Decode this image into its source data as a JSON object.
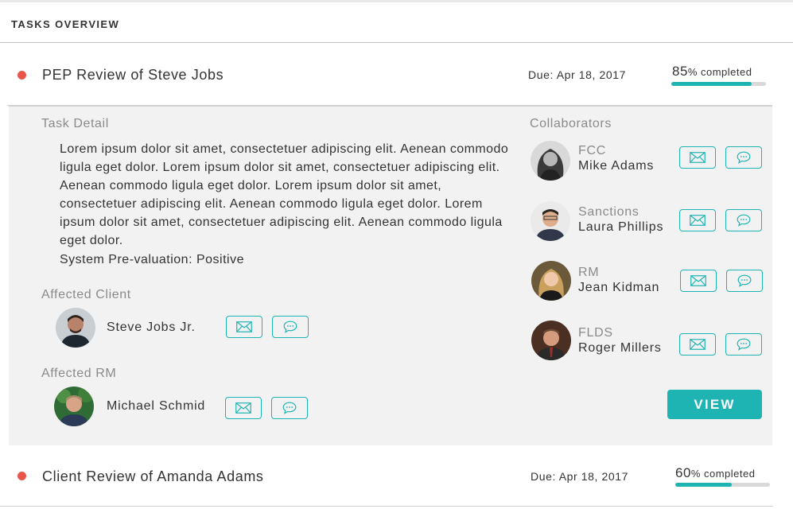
{
  "header": {
    "title": "TASKS OVERVIEW"
  },
  "colors": {
    "accent": "#1fb4b4",
    "status_dot": "#e8574a",
    "muted_text": "#8a8a8a"
  },
  "tasks": [
    {
      "title": "PEP Review of Steve Jobs",
      "due": "Due: Apr 18, 2017",
      "percent": 85,
      "percent_sign": "%",
      "completed_label": " completed",
      "detail": {
        "task_detail_label": "Task Detail",
        "text": "Lorem ipsum dolor sit amet, consectetuer adipiscing elit. Aenean commodo ligula eget dolor. Lorem ipsum dolor sit amet, consectetuer adipiscing elit. Aenean commodo ligula eget dolor. Lorem ipsum dolor sit amet, consectetuer adipiscing elit. Aenean commodo ligula eget dolor. Lorem ipsum dolor sit amet, consectetuer adipiscing elit. Aenean commodo ligula eget dolor.",
        "prevaluation": "System Pre-valuation: Positive",
        "affected_client_label": "Affected Client",
        "affected_client": {
          "name": "Steve Jobs Jr."
        },
        "affected_rm_label": "Affected RM",
        "affected_rm": {
          "name": "Michael Schmid"
        },
        "collaborators_label": "Collaborators",
        "collaborators": [
          {
            "role": "FCC",
            "name": "Mike Adams"
          },
          {
            "role": "Sanctions",
            "name": "Laura Phillips"
          },
          {
            "role": "RM",
            "name": "Jean Kidman"
          },
          {
            "role": "FLDS",
            "name": "Roger Millers"
          }
        ],
        "view_label": "VIEW"
      }
    },
    {
      "title": "Client Review of Amanda Adams",
      "due": "Due: Apr 18, 2017",
      "percent": 60,
      "percent_sign": "%",
      "completed_label": " completed"
    }
  ],
  "icons": {
    "mail": "mail-icon",
    "chat": "chat-icon"
  }
}
